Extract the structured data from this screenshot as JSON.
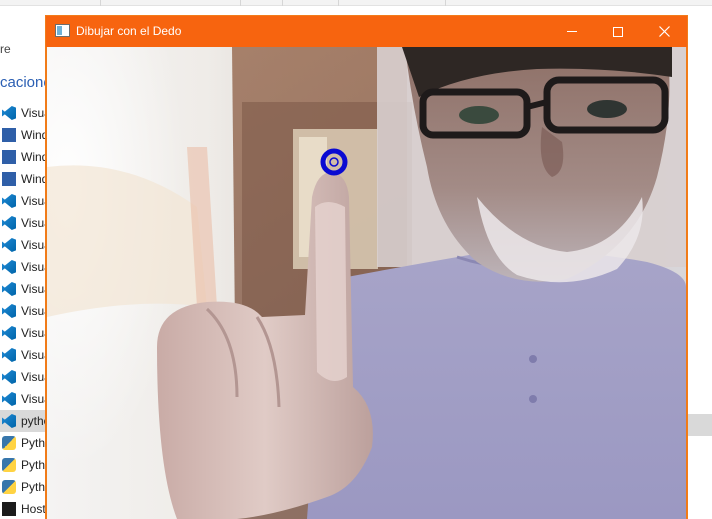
{
  "background_window": {
    "header_fragment": "re",
    "section_fragment": "caciones",
    "items": [
      {
        "label": "Visual",
        "icon": "visual-studio-icon"
      },
      {
        "label": "Wind",
        "icon": "powershell-icon"
      },
      {
        "label": "Wind",
        "icon": "powershell-icon"
      },
      {
        "label": "Wind",
        "icon": "powershell-icon"
      },
      {
        "label": "Visua",
        "icon": "vscode-icon"
      },
      {
        "label": "Visua",
        "icon": "vscode-icon"
      },
      {
        "label": "Visua",
        "icon": "vscode-icon"
      },
      {
        "label": "Visua",
        "icon": "vscode-icon"
      },
      {
        "label": "Visua",
        "icon": "vscode-icon"
      },
      {
        "label": "Visua",
        "icon": "vscode-icon"
      },
      {
        "label": "Visua",
        "icon": "vscode-icon"
      },
      {
        "label": "Visua",
        "icon": "vscode-icon"
      },
      {
        "label": "Visua",
        "icon": "vscode-icon"
      },
      {
        "label": "Visua",
        "icon": "vscode-icon"
      },
      {
        "label": "pytho",
        "icon": "vscode-icon",
        "selected": true
      },
      {
        "label": "Pytho",
        "icon": "python-icon"
      },
      {
        "label": "Pytho",
        "icon": "python-icon"
      },
      {
        "label": "Pytho",
        "icon": "python-icon"
      },
      {
        "label": "Host",
        "icon": "terminal-icon"
      }
    ]
  },
  "app_window": {
    "title": "Dibujar con el Dedo",
    "title_icon": "window-app-icon",
    "titlebar_color": "#f7640f",
    "buttons": {
      "minimize": "minimize-icon",
      "maximize": "maximize-icon",
      "close": "close-icon"
    },
    "camera": {
      "content": "webcam-feed",
      "marker_color": "#0a0ad2"
    }
  },
  "colors": {
    "accent": "#f7640f",
    "link_blue": "#2b5fb3",
    "selection": "#d9d9d9"
  }
}
